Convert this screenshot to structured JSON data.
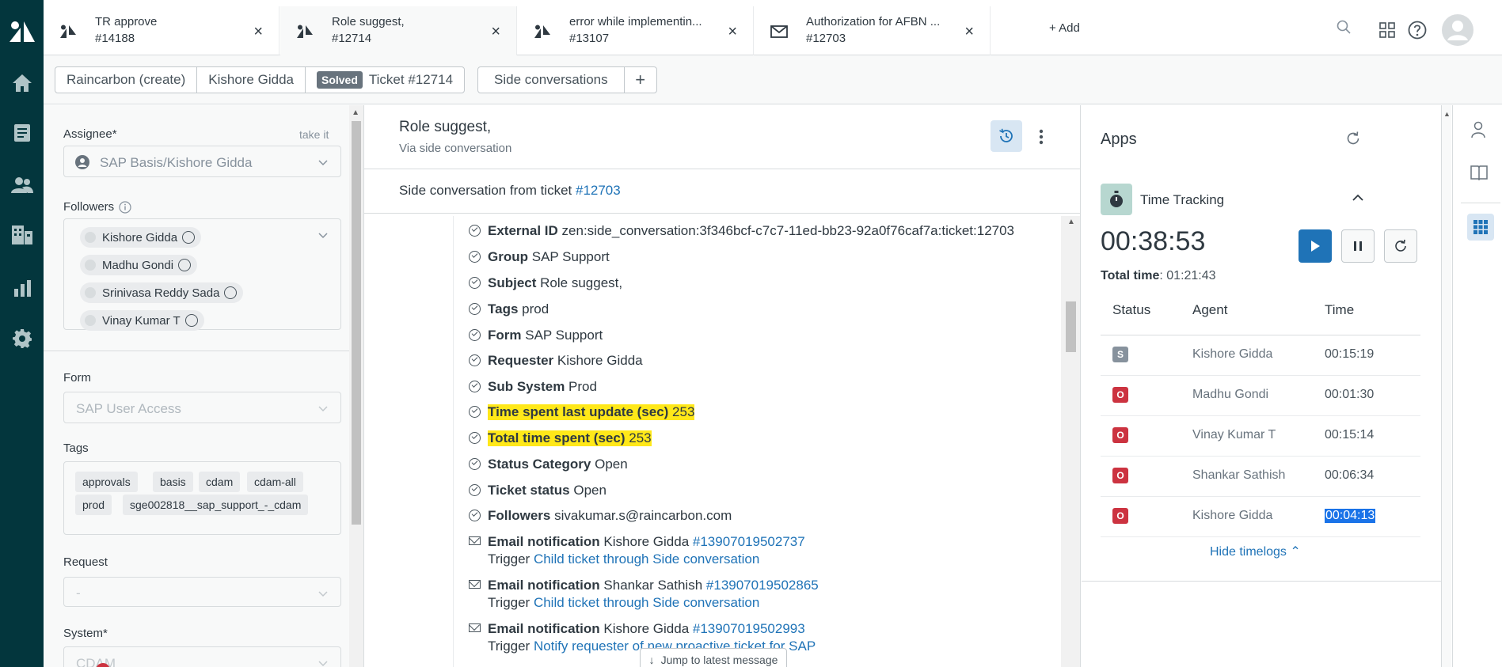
{
  "tabs": [
    {
      "title": "TR approve",
      "sub": "#14188",
      "icon": "zendesk-ticket-icon"
    },
    {
      "title": "Role suggest,",
      "sub": "#12714",
      "icon": "zendesk-ticket-icon"
    },
    {
      "title": "error while implementin...",
      "sub": "#13107",
      "icon": "zendesk-ticket-icon"
    },
    {
      "title": "Authorization for AFBN ...",
      "sub": "#12703",
      "icon": "envelope-icon"
    }
  ],
  "add_tab_label": "+ Add",
  "breadcrumb": {
    "org": "Raincarbon (create)",
    "requester": "Kishore Gidda",
    "status_badge": "Solved",
    "ticket": "Ticket #12714",
    "side_conversations": "Side conversations",
    "add": "+"
  },
  "props": {
    "assignee_label": "Assignee*",
    "take_it": "take it",
    "assignee_value": "SAP Basis/Kishore Gidda",
    "followers_label": "Followers",
    "followers": [
      "Kishore Gidda",
      "Madhu Gondi",
      "Srinivasa Reddy Sada",
      "Vinay Kumar T"
    ],
    "form_label": "Form",
    "form_value": "SAP User Access",
    "tags_label": "Tags",
    "tags_row1": [
      "approvals",
      "basis",
      "cdam",
      "cdam-all"
    ],
    "tags_row2": [
      "prod",
      "sge002818__sap_support_-_cdam"
    ],
    "request_label": "Request",
    "request_value": "-",
    "system_label": "System*",
    "system_value": "CDAM"
  },
  "convo": {
    "title": "Role suggest,",
    "via": "Via side conversation",
    "from_prefix": "Side conversation from ticket ",
    "from_ticket": "#12703",
    "events": [
      {
        "label": "External ID",
        "value": "zen:side_conversation:3f346bcf-c7c7-11ed-bb23-92a0f76caf7a:ticket:12703"
      },
      {
        "label": "Group",
        "value": "SAP Support"
      },
      {
        "label": "Subject",
        "value": "Role suggest,"
      },
      {
        "label": "Tags",
        "value": "prod"
      },
      {
        "label": "Form",
        "value": "SAP Support"
      },
      {
        "label": "Requester",
        "value": "Kishore Gidda"
      },
      {
        "label": "Sub System",
        "value": "Prod"
      },
      {
        "label": "Time spent last update (sec)",
        "value": "253"
      },
      {
        "label": "Total time spent (sec)",
        "value": "253"
      },
      {
        "label": "Status Category",
        "value": "Open"
      },
      {
        "label": "Ticket status",
        "value": "Open"
      },
      {
        "label": "Followers",
        "value": "sivakumar.s@raincarbon.com"
      }
    ],
    "emails": [
      {
        "label": "Email notification",
        "who": "Kishore Gidda",
        "id": "#13907019502737",
        "trigger_label": "Trigger",
        "trigger": "Child ticket through Side conversation"
      },
      {
        "label": "Email notification",
        "who": "Shankar Sathish",
        "id": "#13907019502865",
        "trigger_label": "Trigger",
        "trigger": "Child ticket through Side conversation"
      },
      {
        "label": "Email notification",
        "who": "Kishore Gidda",
        "id": "#13907019502993",
        "trigger_label": "Trigger",
        "trigger": "Notify requester of new proactive ticket for SAP"
      }
    ],
    "jump_label": "Jump to latest message"
  },
  "apps": {
    "title": "Apps",
    "time_tracking": {
      "name": "Time Tracking",
      "clock": "00:38:53",
      "total_label": "Total time",
      "total_value": ": 01:21:43",
      "headers": {
        "status": "Status",
        "agent": "Agent",
        "time": "Time"
      },
      "logs": [
        {
          "status": "S",
          "agent": "Kishore Gidda",
          "time": "00:15:19"
        },
        {
          "status": "O",
          "agent": "Madhu Gondi",
          "time": "00:01:30"
        },
        {
          "status": "O",
          "agent": "Vinay Kumar T",
          "time": "00:15:14"
        },
        {
          "status": "O",
          "agent": "Shankar Sathish",
          "time": "00:06:34"
        },
        {
          "status": "O",
          "agent": "Kishore Gidda",
          "time": "00:04:13"
        }
      ],
      "hide_timelogs": "Hide timelogs ⌃"
    }
  },
  "colors": {
    "nav_bg": "#03363d",
    "link_blue": "#1f73b7",
    "highlight_yellow": "#ffe819",
    "status_open_red": "#cc3340",
    "status_solved_gray": "#87929d"
  }
}
